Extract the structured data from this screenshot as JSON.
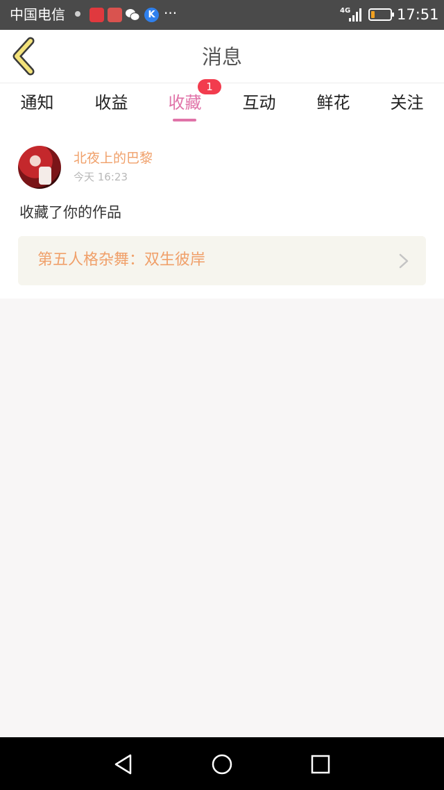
{
  "status_bar": {
    "carrier": "中国电信",
    "network": "4G",
    "time": "17:51",
    "battery_level": 0.2,
    "icons": [
      "notification-dot-icon",
      "shop-app-icon",
      "book-app-icon",
      "wechat-icon",
      "k-app-icon",
      "more-icon"
    ]
  },
  "header": {
    "title": "消息",
    "back_icon": "chevron-left-icon"
  },
  "tabs": [
    {
      "label": "通知"
    },
    {
      "label": "收益"
    },
    {
      "label": "收藏",
      "active": true,
      "badge": "1"
    },
    {
      "label": "互动"
    },
    {
      "label": "鲜花"
    },
    {
      "label": "关注"
    }
  ],
  "notification": {
    "username": "北夜上的巴黎",
    "time": "今天 16:23",
    "action": "收藏了你的作品",
    "work_title": "第五人格杂舞：双生彼岸",
    "link_icon": "chevron-right-icon"
  },
  "nav_bar": {
    "icons": [
      "back-triangle-icon",
      "home-circle-icon",
      "recents-square-icon"
    ]
  },
  "colors": {
    "accent_pink": "#e073a8",
    "orange_text": "#f0a06a",
    "badge_red": "#f23c4e",
    "back_icon_fill": "#f3e27a"
  }
}
